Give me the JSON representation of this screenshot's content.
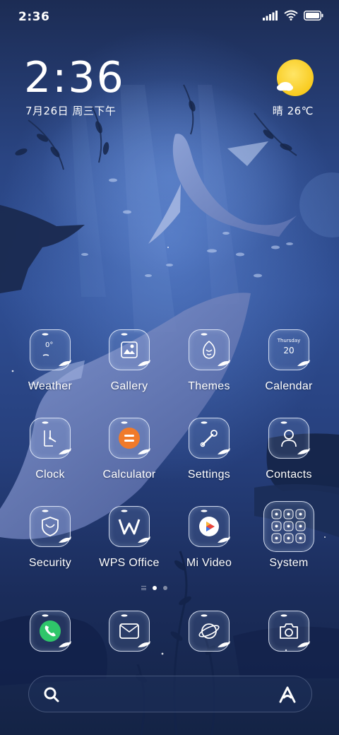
{
  "status_bar": {
    "time": "2:36",
    "icons": [
      "signal-icon",
      "wifi-icon",
      "battery-icon"
    ]
  },
  "clock_widget": {
    "time": "2:36",
    "date": "7月26日 周三下午"
  },
  "weather_widget": {
    "icon": "sun-cloud-icon",
    "text": "晴 26℃"
  },
  "apps": [
    {
      "label": "Weather",
      "icon": "weather-icon",
      "glyph": "0°"
    },
    {
      "label": "Gallery",
      "icon": "gallery-icon"
    },
    {
      "label": "Themes",
      "icon": "themes-icon"
    },
    {
      "label": "Calendar",
      "icon": "calendar-icon",
      "weekday": "Thursday",
      "day": "20"
    },
    {
      "label": "Clock",
      "icon": "clock-icon"
    },
    {
      "label": "Calculator",
      "icon": "calculator-icon"
    },
    {
      "label": "Settings",
      "icon": "settings-icon"
    },
    {
      "label": "Contacts",
      "icon": "contacts-icon"
    },
    {
      "label": "Security",
      "icon": "security-icon"
    },
    {
      "label": "WPS Office",
      "icon": "wps-office-icon"
    },
    {
      "label": "Mi Video",
      "icon": "mi-video-icon"
    },
    {
      "label": "System",
      "icon": "folder-icon"
    }
  ],
  "page_indicator": {
    "pages": 2,
    "current": 1
  },
  "dock": [
    {
      "icon": "phone-icon"
    },
    {
      "icon": "messages-icon"
    },
    {
      "icon": "browser-icon"
    },
    {
      "icon": "camera-icon"
    }
  ],
  "search_bar": {
    "left_icon": "search-icon",
    "right_icon": "assistant-icon"
  },
  "colors": {
    "accent_sun": "#f8c91a",
    "calculator_orange": "#f07a2a",
    "phone_green": "#2fc66a",
    "icon_outline": "#ebf2ff"
  }
}
